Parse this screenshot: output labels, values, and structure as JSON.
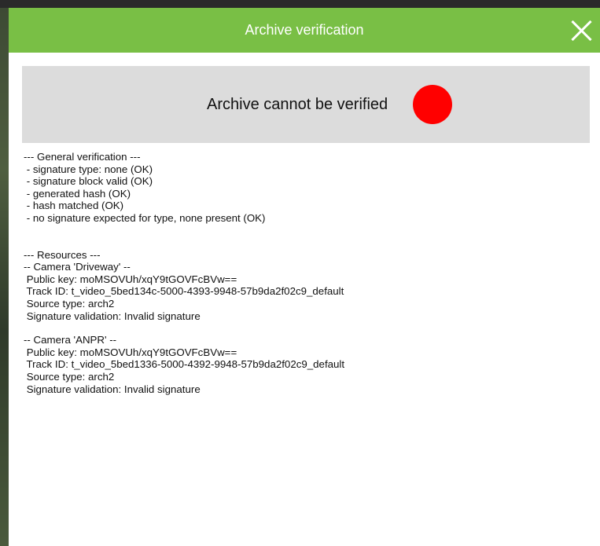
{
  "dialog": {
    "title": "Archive verification",
    "close_icon": "close-icon",
    "accent_color": "#79bf45"
  },
  "status": {
    "text": "Archive cannot be verified",
    "indicator_color": "#ff0000"
  },
  "general": {
    "header": "--- General verification ---",
    "items": [
      " - signature type: none (OK)",
      " - signature block valid (OK)",
      " - generated hash (OK)",
      " - hash matched (OK)",
      " - no signature expected for type, none present (OK)"
    ]
  },
  "resources": {
    "header": "--- Resources ---",
    "cameras": [
      {
        "header": "-- Camera 'Driveway' --",
        "public_key": " Public key: moMSOVUh/xqY9tGOVFcBVw==",
        "track_id": " Track ID: t_video_5bed134c-5000-4393-9948-57b9da2f02c9_default",
        "source_type": " Source type: arch2",
        "signature_validation": " Signature validation: Invalid signature"
      },
      {
        "header": "-- Camera 'ANPR' --",
        "public_key": " Public key: moMSOVUh/xqY9tGOVFcBVw==",
        "track_id": " Track ID: t_video_5bed1336-5000-4392-9948-57b9da2f02c9_default",
        "source_type": " Source type: arch2",
        "signature_validation": " Signature validation: Invalid signature"
      }
    ]
  }
}
